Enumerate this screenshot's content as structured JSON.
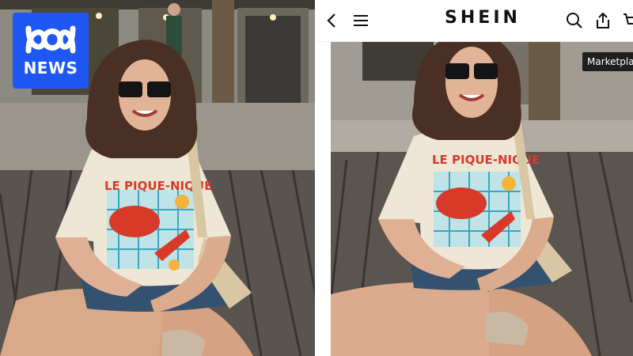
{
  "publisher": {
    "name": "ABC NEWS",
    "logo_text": "NEWS"
  },
  "app": {
    "brand": "SHEIN",
    "back_icon": "chevron-left-icon",
    "menu_icon": "hamburger-menu-icon",
    "search_icon": "search-icon",
    "share_icon": "share-icon",
    "cart_icon": "cart-icon",
    "badge_label": "Marketpla"
  },
  "product": {
    "shirt_text": "LE PIQUE-NIQUE"
  },
  "colors": {
    "abc_blue": "#1f57f5",
    "shirt": "#efe7d6",
    "shirt_text": "#d83a2a",
    "denim": "#34516f",
    "boardwalk": "#5b5550"
  }
}
